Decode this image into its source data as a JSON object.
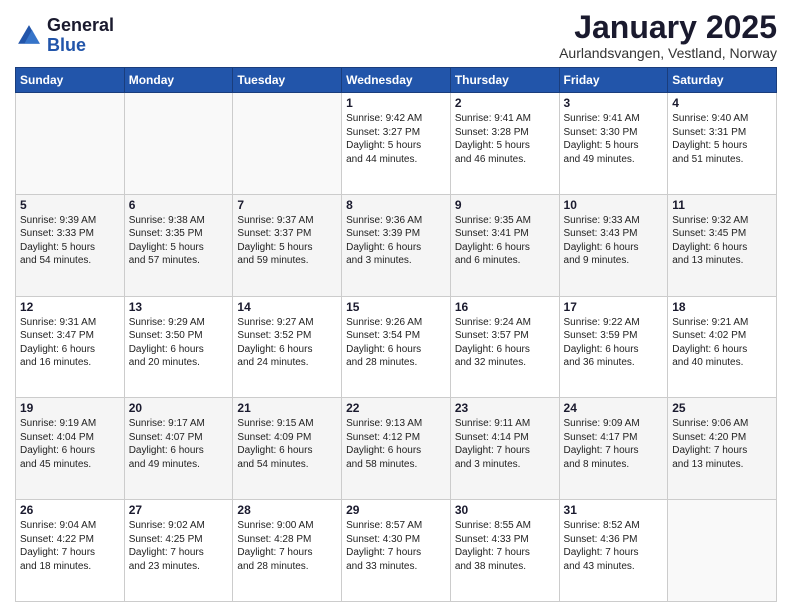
{
  "header": {
    "logo_general": "General",
    "logo_blue": "Blue",
    "title": "January 2025",
    "subtitle": "Aurlandsvangen, Vestland, Norway"
  },
  "weekdays": [
    "Sunday",
    "Monday",
    "Tuesday",
    "Wednesday",
    "Thursday",
    "Friday",
    "Saturday"
  ],
  "weeks": [
    [
      {
        "day": "",
        "info": ""
      },
      {
        "day": "",
        "info": ""
      },
      {
        "day": "",
        "info": ""
      },
      {
        "day": "1",
        "info": "Sunrise: 9:42 AM\nSunset: 3:27 PM\nDaylight: 5 hours\nand 44 minutes."
      },
      {
        "day": "2",
        "info": "Sunrise: 9:41 AM\nSunset: 3:28 PM\nDaylight: 5 hours\nand 46 minutes."
      },
      {
        "day": "3",
        "info": "Sunrise: 9:41 AM\nSunset: 3:30 PM\nDaylight: 5 hours\nand 49 minutes."
      },
      {
        "day": "4",
        "info": "Sunrise: 9:40 AM\nSunset: 3:31 PM\nDaylight: 5 hours\nand 51 minutes."
      }
    ],
    [
      {
        "day": "5",
        "info": "Sunrise: 9:39 AM\nSunset: 3:33 PM\nDaylight: 5 hours\nand 54 minutes."
      },
      {
        "day": "6",
        "info": "Sunrise: 9:38 AM\nSunset: 3:35 PM\nDaylight: 5 hours\nand 57 minutes."
      },
      {
        "day": "7",
        "info": "Sunrise: 9:37 AM\nSunset: 3:37 PM\nDaylight: 5 hours\nand 59 minutes."
      },
      {
        "day": "8",
        "info": "Sunrise: 9:36 AM\nSunset: 3:39 PM\nDaylight: 6 hours\nand 3 minutes."
      },
      {
        "day": "9",
        "info": "Sunrise: 9:35 AM\nSunset: 3:41 PM\nDaylight: 6 hours\nand 6 minutes."
      },
      {
        "day": "10",
        "info": "Sunrise: 9:33 AM\nSunset: 3:43 PM\nDaylight: 6 hours\nand 9 minutes."
      },
      {
        "day": "11",
        "info": "Sunrise: 9:32 AM\nSunset: 3:45 PM\nDaylight: 6 hours\nand 13 minutes."
      }
    ],
    [
      {
        "day": "12",
        "info": "Sunrise: 9:31 AM\nSunset: 3:47 PM\nDaylight: 6 hours\nand 16 minutes."
      },
      {
        "day": "13",
        "info": "Sunrise: 9:29 AM\nSunset: 3:50 PM\nDaylight: 6 hours\nand 20 minutes."
      },
      {
        "day": "14",
        "info": "Sunrise: 9:27 AM\nSunset: 3:52 PM\nDaylight: 6 hours\nand 24 minutes."
      },
      {
        "day": "15",
        "info": "Sunrise: 9:26 AM\nSunset: 3:54 PM\nDaylight: 6 hours\nand 28 minutes."
      },
      {
        "day": "16",
        "info": "Sunrise: 9:24 AM\nSunset: 3:57 PM\nDaylight: 6 hours\nand 32 minutes."
      },
      {
        "day": "17",
        "info": "Sunrise: 9:22 AM\nSunset: 3:59 PM\nDaylight: 6 hours\nand 36 minutes."
      },
      {
        "day": "18",
        "info": "Sunrise: 9:21 AM\nSunset: 4:02 PM\nDaylight: 6 hours\nand 40 minutes."
      }
    ],
    [
      {
        "day": "19",
        "info": "Sunrise: 9:19 AM\nSunset: 4:04 PM\nDaylight: 6 hours\nand 45 minutes."
      },
      {
        "day": "20",
        "info": "Sunrise: 9:17 AM\nSunset: 4:07 PM\nDaylight: 6 hours\nand 49 minutes."
      },
      {
        "day": "21",
        "info": "Sunrise: 9:15 AM\nSunset: 4:09 PM\nDaylight: 6 hours\nand 54 minutes."
      },
      {
        "day": "22",
        "info": "Sunrise: 9:13 AM\nSunset: 4:12 PM\nDaylight: 6 hours\nand 58 minutes."
      },
      {
        "day": "23",
        "info": "Sunrise: 9:11 AM\nSunset: 4:14 PM\nDaylight: 7 hours\nand 3 minutes."
      },
      {
        "day": "24",
        "info": "Sunrise: 9:09 AM\nSunset: 4:17 PM\nDaylight: 7 hours\nand 8 minutes."
      },
      {
        "day": "25",
        "info": "Sunrise: 9:06 AM\nSunset: 4:20 PM\nDaylight: 7 hours\nand 13 minutes."
      }
    ],
    [
      {
        "day": "26",
        "info": "Sunrise: 9:04 AM\nSunset: 4:22 PM\nDaylight: 7 hours\nand 18 minutes."
      },
      {
        "day": "27",
        "info": "Sunrise: 9:02 AM\nSunset: 4:25 PM\nDaylight: 7 hours\nand 23 minutes."
      },
      {
        "day": "28",
        "info": "Sunrise: 9:00 AM\nSunset: 4:28 PM\nDaylight: 7 hours\nand 28 minutes."
      },
      {
        "day": "29",
        "info": "Sunrise: 8:57 AM\nSunset: 4:30 PM\nDaylight: 7 hours\nand 33 minutes."
      },
      {
        "day": "30",
        "info": "Sunrise: 8:55 AM\nSunset: 4:33 PM\nDaylight: 7 hours\nand 38 minutes."
      },
      {
        "day": "31",
        "info": "Sunrise: 8:52 AM\nSunset: 4:36 PM\nDaylight: 7 hours\nand 43 minutes."
      },
      {
        "day": "",
        "info": ""
      }
    ]
  ]
}
